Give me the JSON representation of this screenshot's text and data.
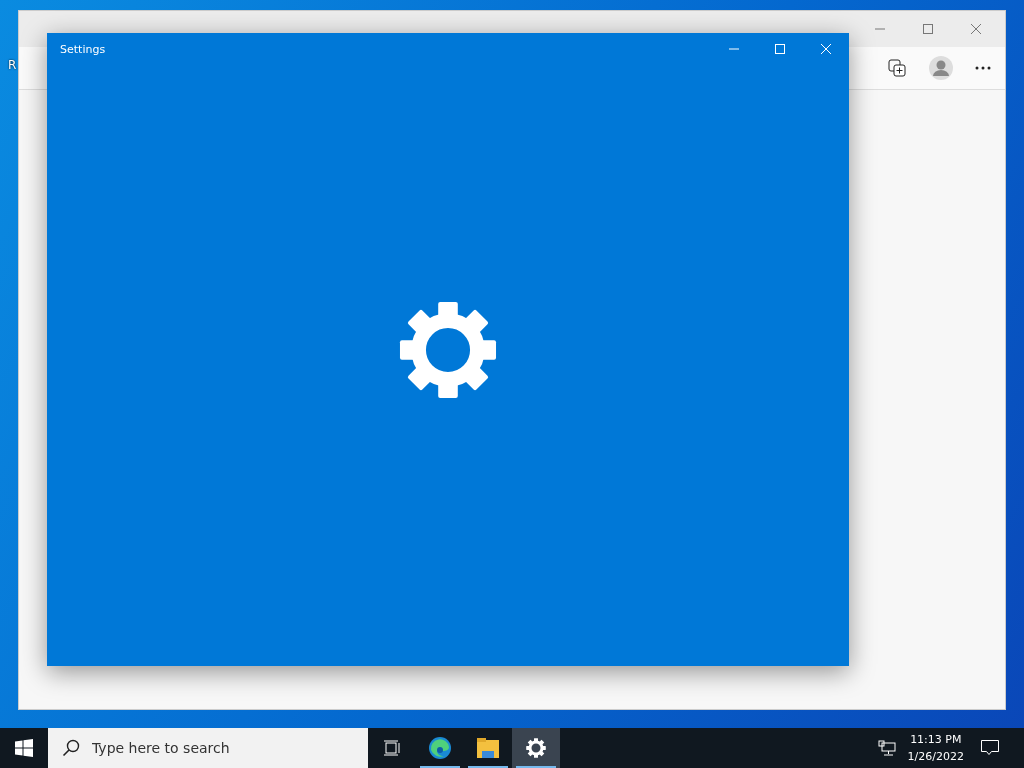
{
  "desktop_label": "R",
  "settings_window": {
    "title": "Settings"
  },
  "taskbar": {
    "search": {
      "placeholder": "Type here to search"
    },
    "apps": [
      {
        "kind": "taskview",
        "running": false,
        "active": false
      },
      {
        "kind": "edge",
        "running": true,
        "active": false
      },
      {
        "kind": "explorer",
        "running": true,
        "active": false
      },
      {
        "kind": "settings",
        "running": true,
        "active": true
      }
    ],
    "time": "11:13 PM",
    "date": "1/26/2022"
  }
}
